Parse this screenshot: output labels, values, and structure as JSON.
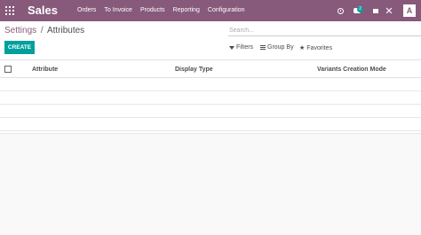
{
  "navbar": {
    "app_name": "Sales",
    "menu": [
      "Orders",
      "To Invoice",
      "Products",
      "Reporting",
      "Configuration"
    ],
    "chat_badge": "2",
    "avatar_initial": "A"
  },
  "breadcrumb": {
    "parent": "Settings",
    "separator": "/",
    "current": "Attributes"
  },
  "search": {
    "placeholder": "Search..."
  },
  "toolbar": {
    "create_label": "CREATE",
    "filters_label": "Filters",
    "groupby_label": "Group By",
    "favorites_label": "Favorites"
  },
  "table": {
    "columns": [
      "Attribute",
      "Display Type",
      "Variants Creation Mode"
    ],
    "rows": []
  }
}
